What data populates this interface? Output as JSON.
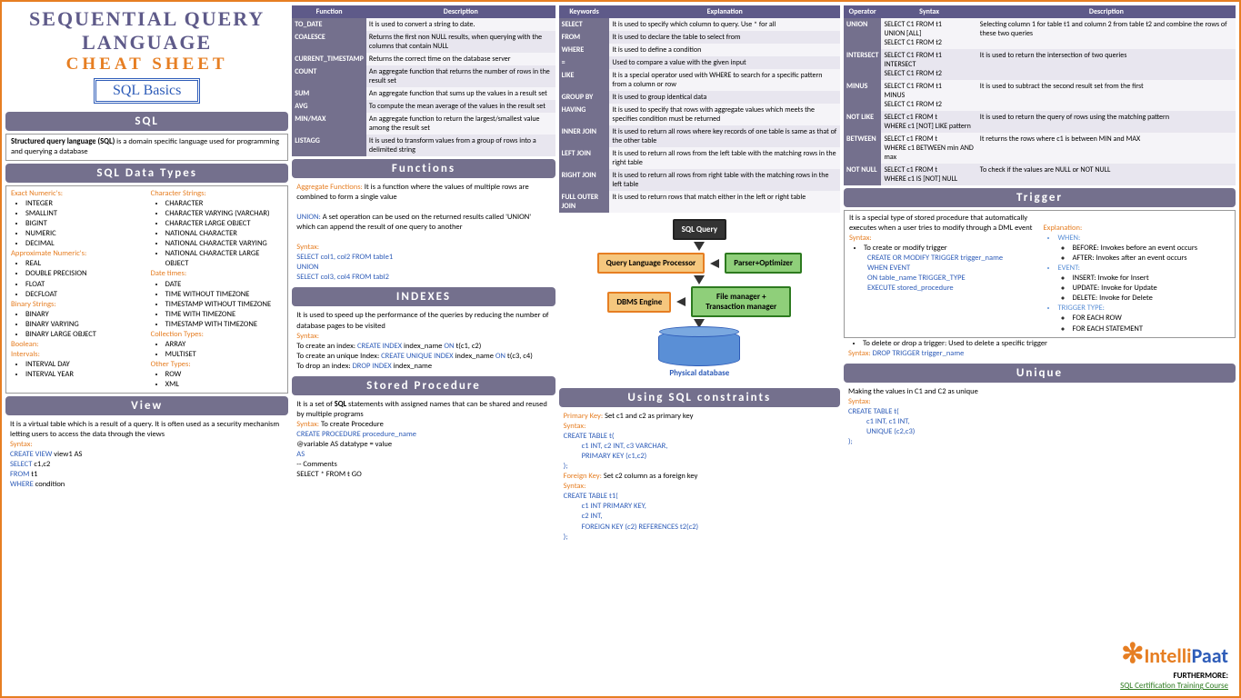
{
  "title": {
    "line1": "SEQUENTIAL QUERY",
    "line2": "LANGUAGE",
    "line3": "CHEAT SHEET",
    "badge": "SQL Basics"
  },
  "sql": {
    "header": "SQL",
    "body": "Structured query language (SQL) is a domain specific language used for programming and querying a database"
  },
  "datatypes": {
    "header": "SQL Data Types",
    "exact_label": "Exact Numeric's:",
    "exact": [
      "INTEGER",
      "SMALLINT",
      "BIGINT",
      "NUMERIC",
      "DECIMAL"
    ],
    "approx_label": "Approximate Numeric's:",
    "approx": [
      "REAL",
      "DOUBLE PRECISION",
      "FLOAT",
      "DECFLOAT"
    ],
    "binary_label": "Binary Strings:",
    "binary": [
      "BINARY",
      "BINARY VARYING",
      "BINARY LARGE OBJECT"
    ],
    "boolean_label": "Boolean:",
    "intervals_label": "Intervals:",
    "intervals": [
      "INTERVAL DAY",
      "INTERVAL YEAR"
    ],
    "char_label": "Character Strings:",
    "char": [
      "CHARACTER",
      "CHARACTER VARYING (VARCHAR)",
      "CHARACTER LARGE OBJECT",
      "NATIONAL CHARACTER",
      "NATIONAL CHARACTER VARYING",
      "NATIONAL CHARACTER LARGE OBJECT"
    ],
    "date_label": "Date times:",
    "date": [
      "DATE",
      "TIME WITHOUT TIMEZONE",
      "TIMESTAMP WITHOUT TIMEZONE",
      "TIME WITH TIMEZONE",
      "TIMESTAMP WITH TIMEZONE"
    ],
    "coll_label": "Collection Types:",
    "coll": [
      "ARRAY",
      "MULTISET"
    ],
    "other_label": "Other Types:",
    "other": [
      "ROW",
      "XML"
    ]
  },
  "view": {
    "header": "View",
    "body": "It is a virtual table which is a result of a query. It is often used as a security mechanism letting users to access the data through the views",
    "syntax_label": "Syntax:",
    "lines": [
      "CREATE VIEW view1 AS",
      "SELECT c1,c2",
      "FROM t1",
      "WHERE condition"
    ]
  },
  "funcs_table": {
    "h1": "Function",
    "h2": "Description",
    "rows": [
      [
        "TO_DATE",
        "It is used to convert a string to date."
      ],
      [
        "COALESCE",
        "Returns the first non NULL results, when querying with the columns that contain NULL"
      ],
      [
        "CURRENT_TIMESTAMP",
        "Returns the correct time on the database server"
      ],
      [
        "COUNT",
        "An aggregate function that returns the number of rows in the result set"
      ],
      [
        "SUM",
        "An aggregate function that sums up the values in a result set"
      ],
      [
        "AVG",
        "To compute the mean average of the values in the result set"
      ],
      [
        "MIN/MAX",
        "An aggregate function to return the largest/smallest value among the result set"
      ],
      [
        "LISTAGG",
        "It is used to transform values from a group of rows into a delimited string"
      ]
    ]
  },
  "functions": {
    "header": "Functions",
    "agg_label": "Aggregate Functions:",
    "agg": "It is a function where the values of multiple rows are combined to form a single value",
    "union_label": "UNION:",
    "union": "A set operation can be used on the returned results called 'UNION' which can append the result of one query to another",
    "syntax_label": "Syntax:",
    "lines": [
      "SELECT col1, col2 FROM table1",
      "UNION",
      "SELECT col3, col4 FROM tabl2"
    ]
  },
  "indexes": {
    "header": "INDEXES",
    "body": "It is used to speed up the performance of the queries by reducing the number of database pages to be visited",
    "syntax_label": "Syntax:",
    "l1a": "To create an index:",
    "l1b": "CREATE INDEX",
    "l1c": "index_name",
    "l1d": "ON",
    "l1e": "t(c1, c2)",
    "l2a": "To create an unique Index:",
    "l2b": "CREATE UNIQUE INDEX",
    "l2c": "index_name",
    "l2d": "ON",
    "l2e": "t(c3, c4)",
    "l3a": "To drop an index:",
    "l3b": "DROP INDEX",
    "l3c": "index_name"
  },
  "sp": {
    "header": "Stored Procedure",
    "body": "It is a set of SQL statements with assigned names that can be shared and reused by multiple programs",
    "syntax_label": "Syntax:",
    "syntax_desc": "To create Procedure",
    "lines": [
      "CREATE PROCEDURE procedure_name",
      "@variable AS datatype = value",
      "AS",
      "-- Comments",
      "SELECT * FROM t GO"
    ]
  },
  "keywords": {
    "h1": "Keywords",
    "h2": "Explanation",
    "rows": [
      [
        "SELECT",
        "It is used to specify which column to query. Use * for all"
      ],
      [
        "FROM",
        "It is used to declare the table to select from"
      ],
      [
        "WHERE",
        "It is used to define a condition"
      ],
      [
        "=",
        "Used to compare a value with the given input"
      ],
      [
        "LIKE",
        "It is a special operator used with WHERE to search for a specific pattern from a column or row"
      ],
      [
        "GROUP BY",
        "It is used to group identical data"
      ],
      [
        "HAVING",
        "It is used to specify that rows with aggregate values which meets the specifies condition must be returned"
      ],
      [
        "INNER JOIN",
        "It is used to return all rows where key records of one table is same as that of the other table"
      ],
      [
        "LEFT JOIN",
        "It is used to return all rows from the left table with the matching rows in the right table"
      ],
      [
        "RIGHT JOIN",
        "It is used to return all rows from right table with the matching rows in the left table"
      ],
      [
        "FULL OUTER JOIN",
        "It is used to return rows that match either in the left or right table"
      ]
    ]
  },
  "flow": {
    "sqlquery": "SQL Query",
    "qlp": "Query Language Processor",
    "parser": "Parser+Optimizer",
    "dbms": "DBMS Engine",
    "fm": "File manager + Transaction manager",
    "db": "Physical database"
  },
  "constraints": {
    "header": "Using SQL constraints",
    "pk_label": "Primary Key:",
    "pk": "Set c1 and c2 as primary key",
    "pk_lines": [
      "CREATE TABLE t(",
      "c1 INT, c2 INT, c3 VARCHAR,",
      "PRIMARY KEY (c1,c2)",
      ");"
    ],
    "fk_label": "Foreign Key:",
    "fk": "Set c2 column as a foreign key",
    "fk_lines": [
      "CREATE TABLE t1(",
      "c1 INT PRIMARY KEY,",
      "c2 INT,",
      "FOREIGN KEY (c2) REFERENCES t2(c2)",
      ");"
    ],
    "syntax_label": "Syntax:"
  },
  "operators": {
    "h1": "Operator",
    "h2": "Syntax",
    "h3": "Description",
    "rows": [
      [
        "UNION",
        "SELECT C1 FROM t1\nUNION [ALL]\nSELECT C1 FROM t2",
        "Selecting column 1 for table t1 and column 2 from table t2 and combine the rows of these two queries"
      ],
      [
        "INTERSECT",
        "SELECT C1 FROM t1\nINTERSECT\nSELECT C1 FROM t2",
        "It is used to return the intersection of two queries"
      ],
      [
        "MINUS",
        "SELECT C1 FROM t1\nMINUS\nSELECT C1 FROM t2",
        "It is used to subtract the second result set from the first"
      ],
      [
        "NOT LIKE",
        "SELECT c1 FROM t\nWHERE c1 [NOT] LIKE pattern",
        "It is used to return the query of rows using the matching pattern"
      ],
      [
        "BETWEEN",
        "SELECT c1 FROM t\nWHERE c1 BETWEEN min AND max",
        "It returns the rows where c1 is between MIN and MAX"
      ],
      [
        "NOT NULL",
        "SELECT c1 FROM t\nWHERE c1 IS [NOT] NULL",
        "To check if the values are NULL or NOT NULL"
      ]
    ]
  },
  "trigger": {
    "header": "Trigger",
    "body": "It is a special type of stored procedure that automatically executes when a user tries to modify through a DML event",
    "syntax_label": "Syntax:",
    "create": "To create or modify trigger",
    "create_lines": [
      "CREATE OR MODIFY TRIGGER trigger_name",
      "WHEN EVENT",
      "ON table_name TRIGGER_TYPE",
      "EXECUTE stored_procedure"
    ],
    "exp_label": "Explanation:",
    "when_label": "WHEN:",
    "when": [
      "BEFORE: Invokes before an event occurs",
      "AFTER: Invokes after an event occurs"
    ],
    "event_label": "EVENT:",
    "event": [
      "INSERT: Invoke for Insert",
      "UPDATE: Invoke for Update",
      "DELETE: Invoke for Delete"
    ],
    "tt_label": "TRIGGER TYPE:",
    "tt": [
      "FOR EACH ROW",
      "FOR EACH STATEMENT"
    ],
    "delete": "To delete or drop a trigger: Used to delete a specific trigger",
    "delete_syntax": "DROP TRIGGER trigger_name"
  },
  "unique": {
    "header": "Unique",
    "body": "Making the values in C1 and C2 as unique",
    "syntax_label": "Syntax:",
    "lines": [
      "CREATE TABLE t(",
      "c1 INT, c1 INT,",
      "UNIQUE (c2,c3)",
      ");"
    ]
  },
  "footer": {
    "further": "FURTHERMORE:",
    "link": "SQL Certification Training Course",
    "logo1": "Intelli",
    "logo2": "Paat"
  }
}
